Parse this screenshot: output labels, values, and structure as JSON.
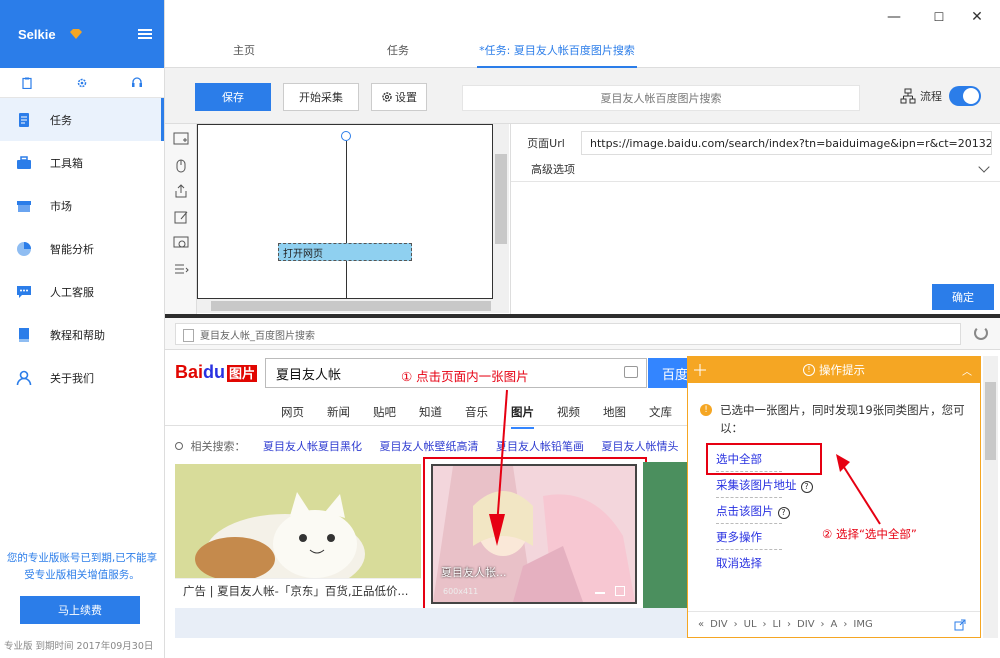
{
  "app": {
    "name": "Selkie",
    "window_controls": [
      "—",
      "☐",
      "✕"
    ]
  },
  "sidebar": {
    "items": [
      {
        "label": "任务"
      },
      {
        "label": "工具箱"
      },
      {
        "label": "市场"
      },
      {
        "label": "智能分析"
      },
      {
        "label": "人工客服"
      },
      {
        "label": "教程和帮助"
      },
      {
        "label": "关于我们"
      }
    ],
    "expire_notice": "您的专业版账号已到期,已不能享受专业版相关增值服务。",
    "renew_label": "马上续费",
    "version_info": "专业版  到期时间  2017年09月30日"
  },
  "tabs": [
    {
      "label": "主页"
    },
    {
      "label": "任务"
    },
    {
      "label": "*任务: 夏目友人帐百度图片搜索"
    }
  ],
  "toolbar": {
    "save_label": "保存",
    "start_label": "开始采集",
    "settings_label": "设置",
    "task_name": "夏目友人帐百度图片搜索",
    "flow_label": "流程"
  },
  "workflow": {
    "node_label": "打开网页"
  },
  "right_panel": {
    "url_label": "页面Url",
    "url_value": "https://image.baidu.com/search/index?tn=baiduimage&ipn=r&ct=2013265",
    "advanced_label": "高级选项",
    "ok_label": "确定"
  },
  "browser": {
    "address": "夏目友人帐_百度图片搜索",
    "search_query": "夏目友人帐",
    "search_button": "百度",
    "step1": "① 点击页面内一张图片",
    "nav_tabs": [
      "网页",
      "新闻",
      "贴吧",
      "知道",
      "音乐",
      "图片",
      "视频",
      "地图",
      "文库"
    ],
    "related_label": "相关搜索：",
    "related_items": [
      "夏目友人帐夏目黑化",
      "夏目友人帐壁纸高清",
      "夏目友人帐铅笔画",
      "夏目友人帐情头"
    ],
    "ad_text": "广告 | 夏目友人帐-「京东」百货,正品低价...",
    "image_caption": "夏目友人帐...",
    "image_dims": "600x411"
  },
  "tip": {
    "title": "操作提示",
    "message": "已选中一张图片，同时发现19张同类图片，您可以：",
    "actions": [
      "选中全部",
      "采集该图片地址",
      "点击该图片",
      "更多操作",
      "取消选择"
    ],
    "step2": "② 选择“选中全部”",
    "path": [
      "«",
      "DIV",
      "›",
      "UL",
      "›",
      "LI",
      "›",
      "DIV",
      "›",
      "A",
      "›",
      "IMG"
    ]
  },
  "colors": {
    "accent": "#2b7de9",
    "tip_orange": "#f5a623",
    "annotation_red": "#e60012"
  }
}
